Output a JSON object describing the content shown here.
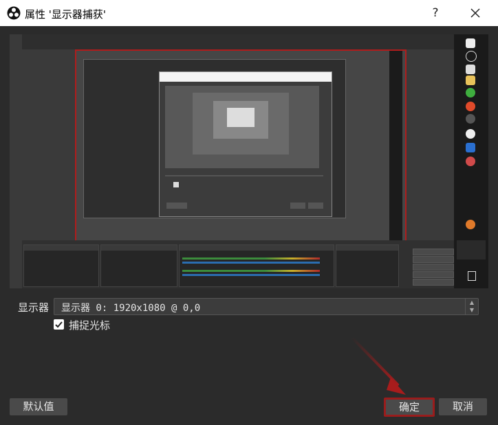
{
  "window": {
    "title": "属性 '显示器捕获'",
    "help_label": "?",
    "close_icon": "close-icon",
    "app_icon": "obs-logo-icon"
  },
  "preview": {
    "description_icon": "display-capture-preview"
  },
  "form": {
    "display_label": "显示器",
    "display_value": "显示器 0: 1920x1080 @ 0,0",
    "capture_cursor_label": "捕捉光标",
    "capture_cursor_checked": true
  },
  "buttons": {
    "defaults": "默认值",
    "ok": "确定",
    "cancel": "取消"
  },
  "colors": {
    "background": "#2b2b2b",
    "highlight_red": "#9a1c1c",
    "button": "#4a4a4a",
    "text": "#e6e6e6"
  }
}
